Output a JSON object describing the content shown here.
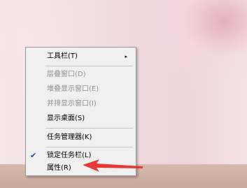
{
  "context_menu": {
    "items": [
      {
        "label": "工具栏(T)",
        "disabled": false,
        "submenu": true
      },
      {
        "label": "层叠窗口(D)",
        "disabled": true
      },
      {
        "label": "堆叠显示窗口(E)",
        "disabled": true
      },
      {
        "label": "并排显示窗口(I)",
        "disabled": true
      },
      {
        "label": "显示桌面(S)",
        "disabled": false
      },
      {
        "label": "任务管理器(K)",
        "disabled": false
      },
      {
        "label": "锁定任务栏(L)",
        "disabled": false,
        "checked": true
      },
      {
        "label": "属性(R)",
        "disabled": false
      }
    ],
    "submenu_arrow": "▸",
    "check_mark": "✔"
  },
  "annotation": {
    "color": "#e53935"
  }
}
